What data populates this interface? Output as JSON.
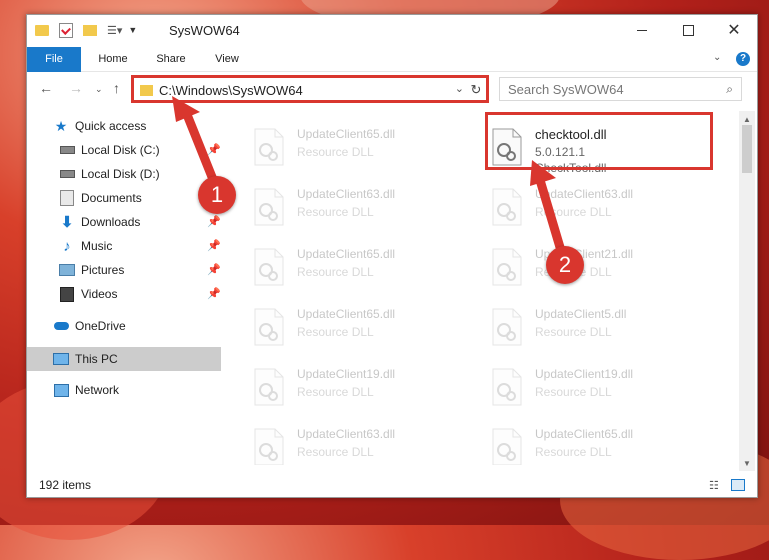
{
  "window": {
    "title": "SysWOW64"
  },
  "ribbon": {
    "tabs": [
      "File",
      "Home",
      "Share",
      "View"
    ]
  },
  "address": {
    "path": "C:\\Windows\\SysWOW64"
  },
  "search": {
    "placeholder": "Search SysWOW64"
  },
  "nav": {
    "items": [
      {
        "label": "Quick access",
        "icon": "star-icon"
      },
      {
        "label": "Local Disk (C:)",
        "icon": "drive-icon",
        "pinned": true
      },
      {
        "label": "Local Disk (D:)",
        "icon": "drive-icon"
      },
      {
        "label": "Documents",
        "icon": "documents-icon"
      },
      {
        "label": "Downloads",
        "icon": "download-icon",
        "pinned": true
      },
      {
        "label": "Music",
        "icon": "music-icon",
        "pinned": true
      },
      {
        "label": "Pictures",
        "icon": "pictures-icon",
        "pinned": true
      },
      {
        "label": "Videos",
        "icon": "videos-icon",
        "pinned": true
      },
      {
        "label": "OneDrive",
        "icon": "cloud-icon"
      },
      {
        "label": "This PC",
        "icon": "monitor-icon",
        "selected": true
      },
      {
        "label": "Network",
        "icon": "network-icon"
      }
    ]
  },
  "files": [
    {
      "name": "UpdateClient65.dll",
      "desc": "Resource DLL"
    },
    {
      "name": "checktool.dll",
      "version": "5.0.121.1",
      "desc": "CheckTool.dll",
      "highlighted": true
    },
    {
      "name": "UpdateClient63.dll",
      "desc": "Resource DLL"
    },
    {
      "name": "UpdateClient63.dll",
      "desc": "Resource DLL"
    },
    {
      "name": "UpdateClient65.dll",
      "desc": "Resource DLL"
    },
    {
      "name": "UpdateClient21.dll",
      "desc": "Resource DLL"
    },
    {
      "name": "UpdateClient65.dll",
      "desc": "Resource DLL"
    },
    {
      "name": "UpdateClient5.dll",
      "desc": "Resource DLL"
    },
    {
      "name": "UpdateClient19.dll",
      "desc": "Resource DLL"
    },
    {
      "name": "UpdateClient19.dll",
      "desc": "Resource DLL"
    },
    {
      "name": "UpdateClient63.dll",
      "desc": "Resource DLL"
    },
    {
      "name": "UpdateClient65.dll",
      "desc": "Resource DLL"
    }
  ],
  "status": {
    "items_count": "192 items"
  },
  "annotations": {
    "step1": "1",
    "step2": "2"
  },
  "colors": {
    "accent": "#1979ca",
    "highlight": "#d9362e"
  }
}
